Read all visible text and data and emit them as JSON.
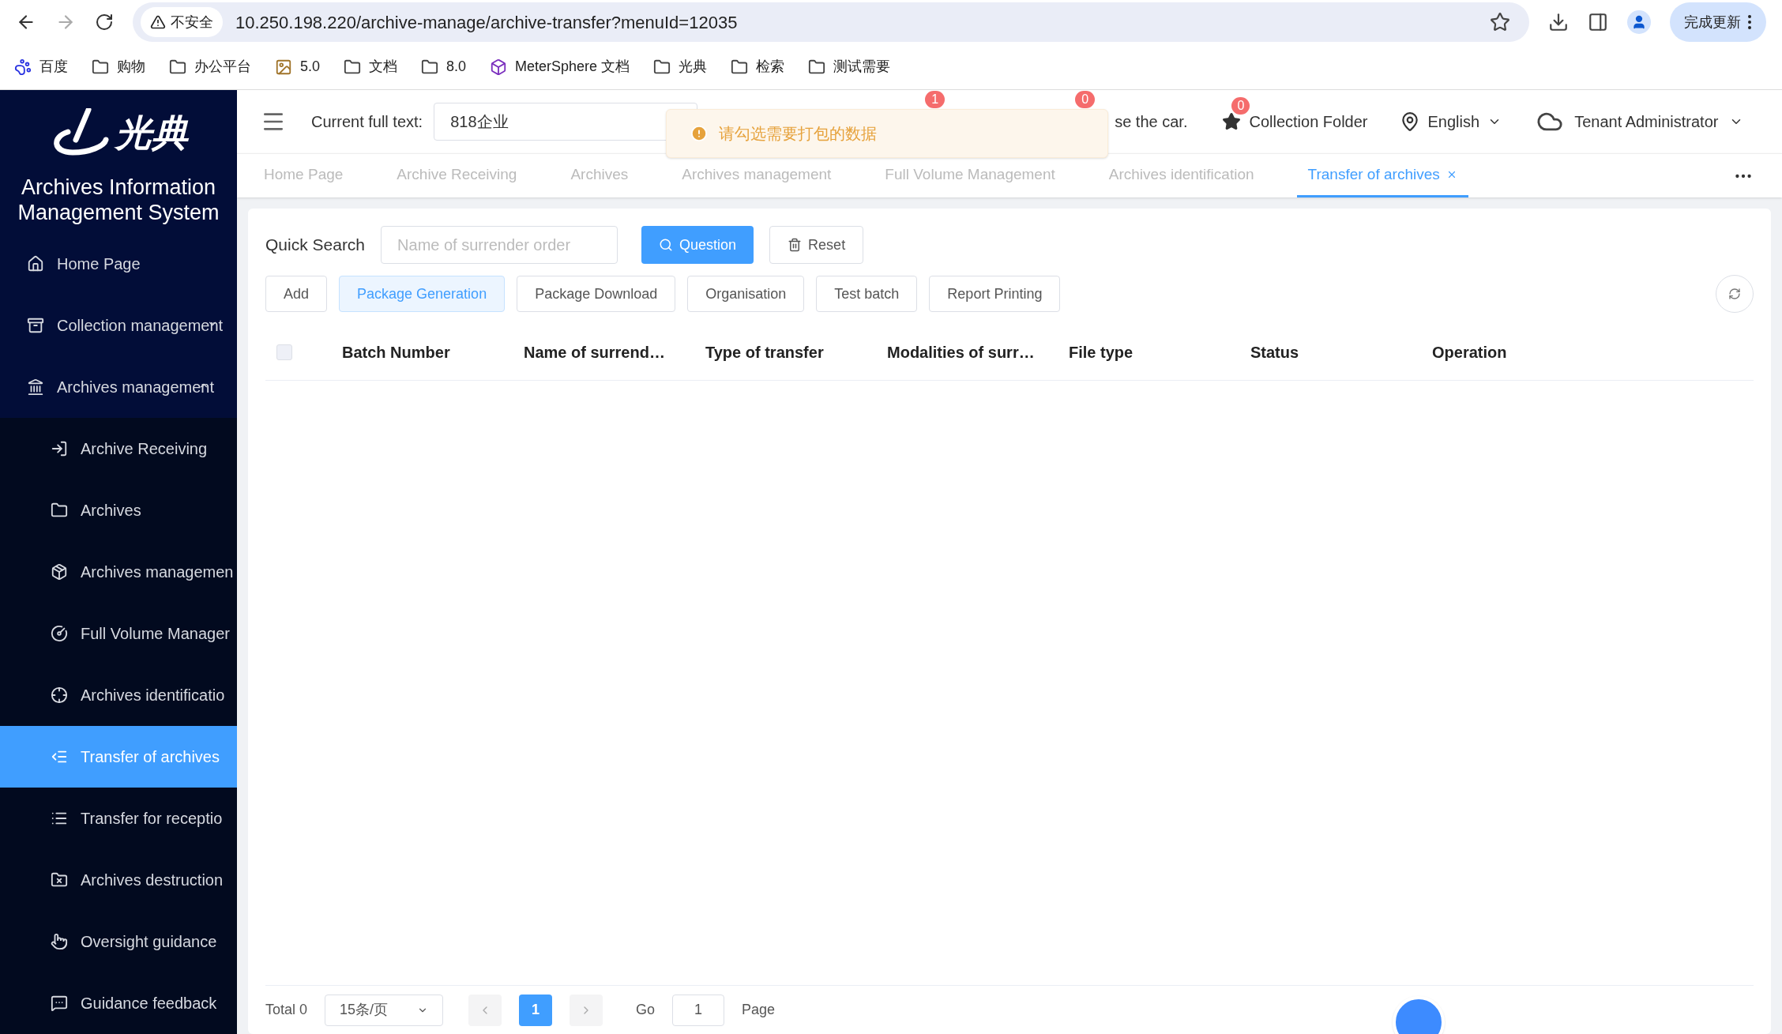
{
  "browser": {
    "security": "不安全",
    "url": "10.250.198.220/archive-manage/archive-transfer?menuId=12035",
    "update_button": "完成更新",
    "bookmarks": [
      {
        "kind": "baidu",
        "label": "百度"
      },
      {
        "kind": "folder",
        "label": "购物"
      },
      {
        "kind": "folder",
        "label": "办公平台"
      },
      {
        "kind": "image",
        "label": "5.0"
      },
      {
        "kind": "folder",
        "label": "文档"
      },
      {
        "kind": "folder",
        "label": "8.0"
      },
      {
        "kind": "cube",
        "label": "MeterSphere 文档"
      },
      {
        "kind": "folder",
        "label": "光典"
      },
      {
        "kind": "folder",
        "label": "检索"
      },
      {
        "kind": "folder",
        "label": "测试需要"
      }
    ]
  },
  "sidebar": {
    "logo_text": "光典",
    "title": "Archives Information Management System",
    "items": [
      {
        "kind": "top",
        "label": "Home Page",
        "selected": false
      },
      {
        "kind": "group",
        "label": "Collection management",
        "expanded": false,
        "selected": false
      },
      {
        "kind": "group",
        "label": "Archives management",
        "expanded": true,
        "selected": false,
        "children": [
          {
            "kind": "sub",
            "label": "Archive Receiving",
            "selected": false
          },
          {
            "kind": "sub",
            "label": "Archives",
            "selected": false
          },
          {
            "kind": "sub",
            "label": "Archives managemen",
            "selected": false
          },
          {
            "kind": "sub",
            "label": "Full Volume Manager",
            "selected": false
          },
          {
            "kind": "sub",
            "label": "Archives identificatio",
            "selected": false
          },
          {
            "kind": "sub",
            "label": "Transfer of archives",
            "selected": true
          },
          {
            "kind": "sub",
            "label": "Transfer for receptio",
            "selected": false
          },
          {
            "kind": "sub",
            "label": "Archives destruction",
            "selected": false
          },
          {
            "kind": "sub",
            "label": "Oversight guidance",
            "selected": false
          },
          {
            "kind": "sub",
            "label": "Guidance feedback",
            "selected": false
          }
        ]
      }
    ]
  },
  "header": {
    "fulltext_label": "Current full text:",
    "fulltext_value": "818企业",
    "badges": [
      "1",
      "0"
    ],
    "partial_text": "se the car.",
    "collection": {
      "badge": "0",
      "label": "Collection Folder"
    },
    "language": "English",
    "user": "Tenant Administrator"
  },
  "toast": {
    "message": "请勾选需要打包的数据"
  },
  "tabs": [
    {
      "label": "Home Page",
      "selected": false,
      "closable": false
    },
    {
      "label": "Archive Receiving",
      "selected": false,
      "closable": false
    },
    {
      "label": "Archives",
      "selected": false,
      "closable": false
    },
    {
      "label": "Archives management",
      "selected": false,
      "closable": false
    },
    {
      "label": "Full Volume Management",
      "selected": false,
      "closable": false
    },
    {
      "label": "Archives identification",
      "selected": false,
      "closable": false
    },
    {
      "label": "Transfer of archives",
      "selected": true,
      "closable": true
    }
  ],
  "search": {
    "label": "Quick Search",
    "placeholder": "Name of surrender order",
    "search_button": "Question",
    "reset_button": "Reset"
  },
  "actions": [
    {
      "label": "Add",
      "highlighted": false
    },
    {
      "label": "Package Generation",
      "highlighted": true
    },
    {
      "label": "Package Download",
      "highlighted": false
    },
    {
      "label": "Organisation",
      "highlighted": false
    },
    {
      "label": "Test batch",
      "highlighted": false
    },
    {
      "label": "Report Printing",
      "highlighted": false
    }
  ],
  "table": {
    "select_all_checked": false,
    "columns": [
      "Batch Number",
      "Name of surrend…",
      "Type of transfer",
      "Modalities of surr…",
      "File type",
      "Status",
      "Operation"
    ]
  },
  "pagination": {
    "total": "Total 0",
    "page_size": "15条/页",
    "pages": [
      {
        "label": "1",
        "selected": true
      }
    ],
    "goto_label": "Go",
    "goto_value": "1",
    "page_label": "Page"
  }
}
